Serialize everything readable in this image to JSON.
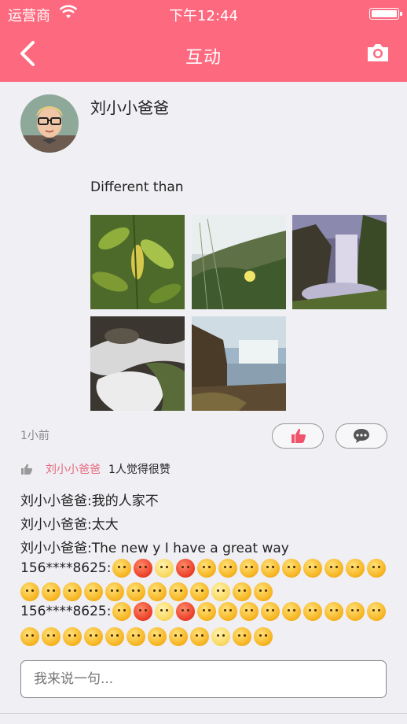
{
  "status_bar": {
    "carrier": "运营商",
    "time": "下午12:44"
  },
  "navbar": {
    "title": "互动",
    "back_icon": "chevron-left-icon",
    "camera_icon": "camera-icon"
  },
  "post": {
    "author": "刘小小爸爸",
    "text": "Different than",
    "photos": [
      "leaf-photo",
      "grass-flower-photo",
      "waterfall-photo",
      "stream-rocks-photo",
      "waterfall-lake-photo"
    ],
    "time_ago": "1小前",
    "like_icon": "thumbs-up-icon",
    "comment_icon": "speech-bubble-icon"
  },
  "likes": {
    "name": "刘小小爸爸",
    "text": "1人觉得很赞"
  },
  "comments": [
    "刘小小爸爸:我的人家不",
    "刘小小爸爸:太大",
    "刘小小爸爸:The new y I have a great way",
    "156****8625:",
    "156****8625:"
  ],
  "input": {
    "placeholder": "我来说一句..."
  },
  "colors": {
    "accent": "#fd6a7f",
    "like_name": "#e9677c",
    "background": "#efeff4"
  }
}
